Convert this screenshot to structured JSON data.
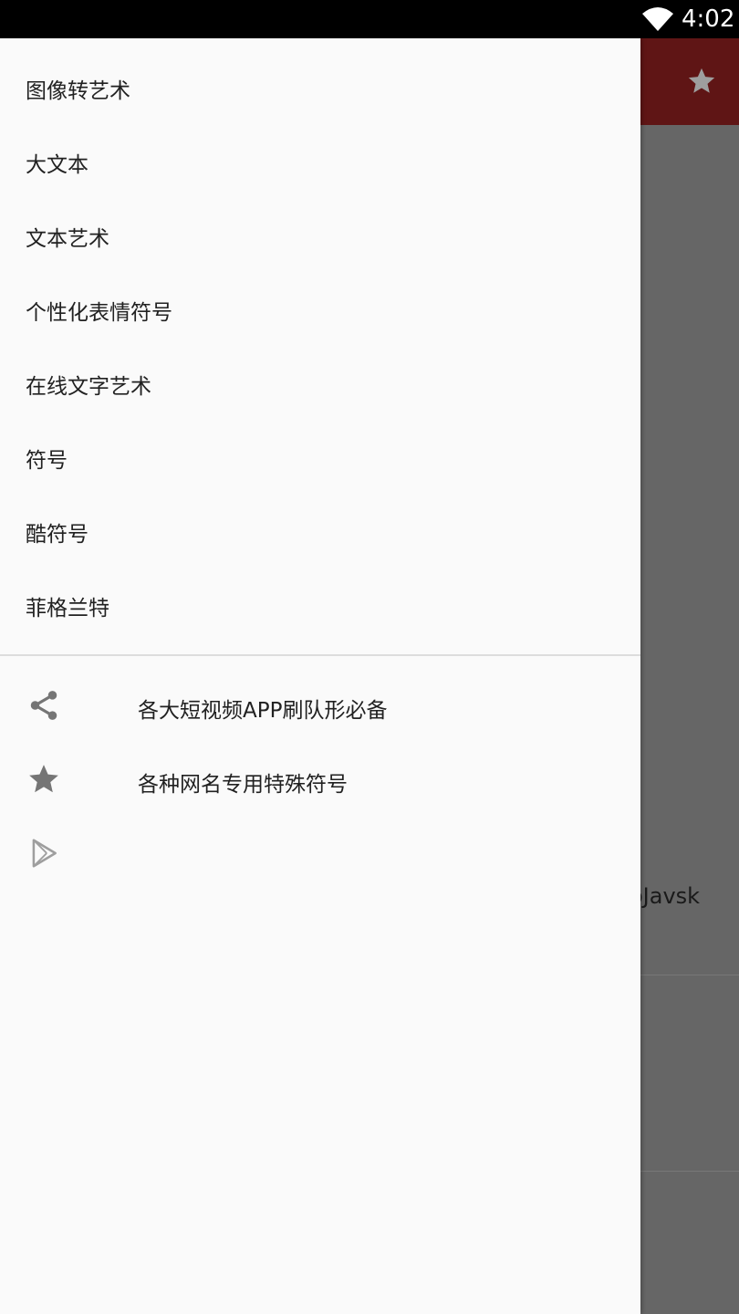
{
  "status_bar": {
    "time": "4:02",
    "wifi_icon": "wifi-icon"
  },
  "app_bar": {
    "action_icon": "star-icon"
  },
  "background": {
    "snippet_text": "oJavsk"
  },
  "drawer": {
    "menu_items": [
      {
        "label": "图像转艺术"
      },
      {
        "label": "大文本"
      },
      {
        "label": "文本艺术"
      },
      {
        "label": "个性化表情符号"
      },
      {
        "label": "在线文字艺术"
      },
      {
        "label": "符号"
      },
      {
        "label": "酷符号"
      },
      {
        "label": "菲格兰特"
      }
    ],
    "icon_items": [
      {
        "icon": "share-icon",
        "label": "各大短视频APP刷队形必备"
      },
      {
        "icon": "star-icon",
        "label": "各种网名专用特殊符号"
      },
      {
        "icon": "play-store-icon",
        "label": ""
      }
    ]
  },
  "colors": {
    "status_bar": "#000000",
    "app_bar": "#5f1515",
    "scrim": "#666666",
    "drawer_bg": "#fafafa",
    "text": "#212121",
    "icon": "#757575"
  }
}
